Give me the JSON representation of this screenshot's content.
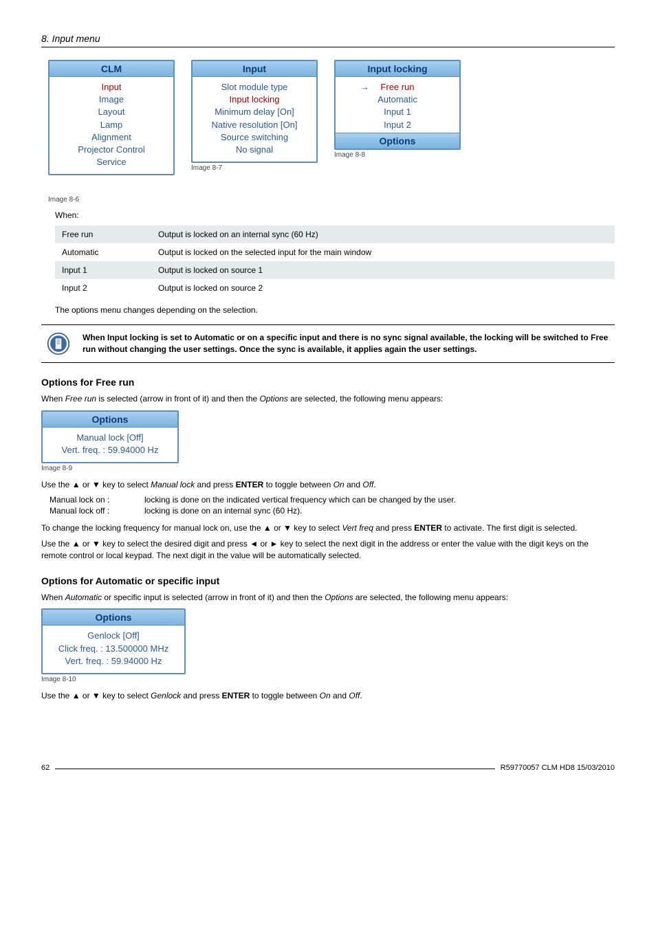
{
  "header": {
    "section": "8. Input menu"
  },
  "figures": {
    "clm": {
      "title": "CLM",
      "items": [
        "Input",
        "Image",
        "Layout",
        "Lamp",
        "Alignment",
        "Projector Control",
        "Service"
      ],
      "caption": "Image 8-6"
    },
    "input": {
      "title": "Input",
      "items": [
        "Slot module type",
        "Input locking",
        "Minimum delay [On]",
        "Native resolution [On]",
        "Source switching",
        "No signal"
      ],
      "caption": "Image 8-7"
    },
    "locking": {
      "title": "Input locking",
      "arrow": "→",
      "items": [
        "Free run",
        "Automatic",
        "Input 1",
        "Input 2"
      ],
      "options": "Options",
      "caption": "Image 8-8"
    }
  },
  "when_label": "When:",
  "when_table": [
    {
      "k": "Free run",
      "v": "Output is locked on an internal sync (60 Hz)"
    },
    {
      "k": "Automatic",
      "v": "Output is locked on the selected input for the main window"
    },
    {
      "k": "Input 1",
      "v": "Output is locked on source 1"
    },
    {
      "k": "Input 2",
      "v": "Output is locked on source 2"
    }
  ],
  "options_changes": "The options menu changes depending on the selection.",
  "note": "When Input locking is set to Automatic or on a specific input and there is no sync signal available, the locking will be switched to Free run without changing the user settings. Once the sync is available, it applies again the user settings.",
  "freerun": {
    "heading": "Options for Free run",
    "intro_a": "When ",
    "intro_i": "Free run",
    "intro_b": " is selected (arrow in front of it) and then the ",
    "intro_i2": "Options",
    "intro_c": " are selected, the following menu appears:",
    "menu": {
      "title": "Options",
      "items": [
        "Manual lock [Off]",
        "Vert. freq. : 59.94000 Hz"
      ],
      "caption": "Image 8-9"
    },
    "use1_a": "Use the ▲ or ▼ key to select ",
    "use1_i": "Manual lock",
    "use1_b": " and press ",
    "use1_s": "ENTER",
    "use1_c": " to toggle between ",
    "use1_i2": "On",
    "use1_d": " and ",
    "use1_i3": "Off",
    "use1_e": ".",
    "ml_on_k": "Manual lock on :",
    "ml_on_v": "locking is done on the indicated vertical frequency which can be changed by the user.",
    "ml_off_k": "Manual lock off :",
    "ml_off_v": "locking is done on an internal sync (60 Hz).",
    "change_a": "To change the locking frequency for manual lock on, use the ▲ or ▼ key to select ",
    "change_i": "Vert freq",
    "change_b": " and press ",
    "change_s": "ENTER",
    "change_c": " to activate. The first digit is selected.",
    "digits": "Use the ▲ or ▼ key to select the desired digit and press ◄ or ► key to select the next digit in the address or enter the value with the digit keys on the remote control or local keypad. The next digit in the value will be automatically selected."
  },
  "auto": {
    "heading": "Options for Automatic or specific input",
    "intro_a": "When ",
    "intro_i": "Automatic",
    "intro_b": " or specific input is selected (arrow in front of it) and then the ",
    "intro_i2": "Options",
    "intro_c": " are selected, the following menu appears:",
    "menu": {
      "title": "Options",
      "items": [
        "Genlock [Off]",
        "Click freq. : 13.500000 MHz",
        "Vert. freq. : 59.94000 Hz"
      ],
      "caption": "Image 8-10"
    },
    "use_a": "Use the ▲ or ▼ key to select ",
    "use_i": "Genlock",
    "use_b": " and press ",
    "use_s": "ENTER",
    "use_c": " to toggle between ",
    "use_i2": "On",
    "use_d": " and ",
    "use_i3": "Off",
    "use_e": "."
  },
  "footer": {
    "page": "62",
    "doc": "R59770057 CLM HD8 15/03/2010"
  }
}
